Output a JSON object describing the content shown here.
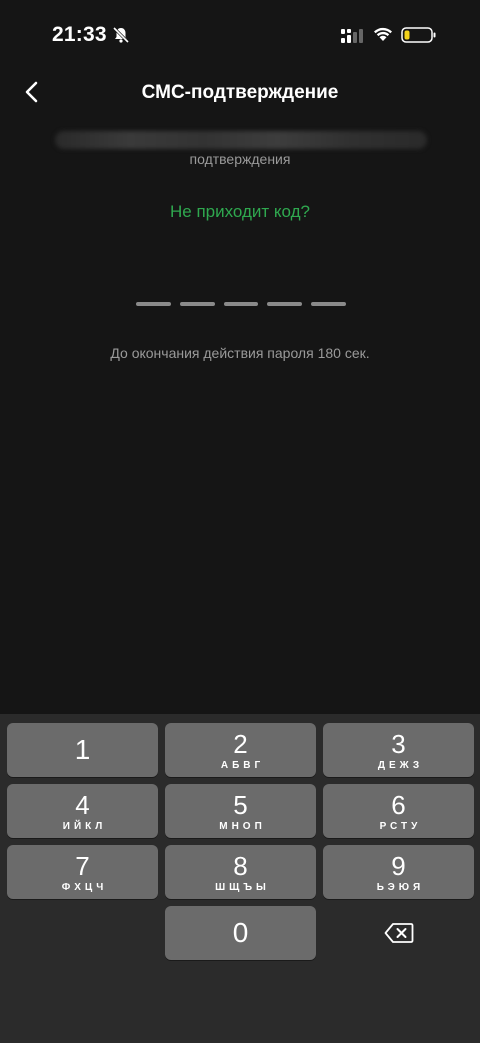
{
  "status_bar": {
    "time": "21:33"
  },
  "header": {
    "title": "СМС-подтверждение"
  },
  "content": {
    "subtitle": "подтверждения",
    "no_code_link": "Не приходит код?",
    "timer": "До окончания действия пароля 180 сек."
  },
  "keyboard": {
    "keys": [
      {
        "digit": "1",
        "letters": ""
      },
      {
        "digit": "2",
        "letters": "АБВГ"
      },
      {
        "digit": "3",
        "letters": "ДЕЖЗ"
      },
      {
        "digit": "4",
        "letters": "ИЙКЛ"
      },
      {
        "digit": "5",
        "letters": "МНОП"
      },
      {
        "digit": "6",
        "letters": "РСТУ"
      },
      {
        "digit": "7",
        "letters": "ФХЦЧ"
      },
      {
        "digit": "8",
        "letters": "ШЩЪЫ"
      },
      {
        "digit": "9",
        "letters": "ЬЭЮЯ"
      },
      {
        "digit": "0",
        "letters": ""
      }
    ]
  },
  "colors": {
    "accent": "#2fa84f",
    "background": "#151515",
    "keyboard": "#2b2b2b",
    "key": "#6b6b6b"
  }
}
